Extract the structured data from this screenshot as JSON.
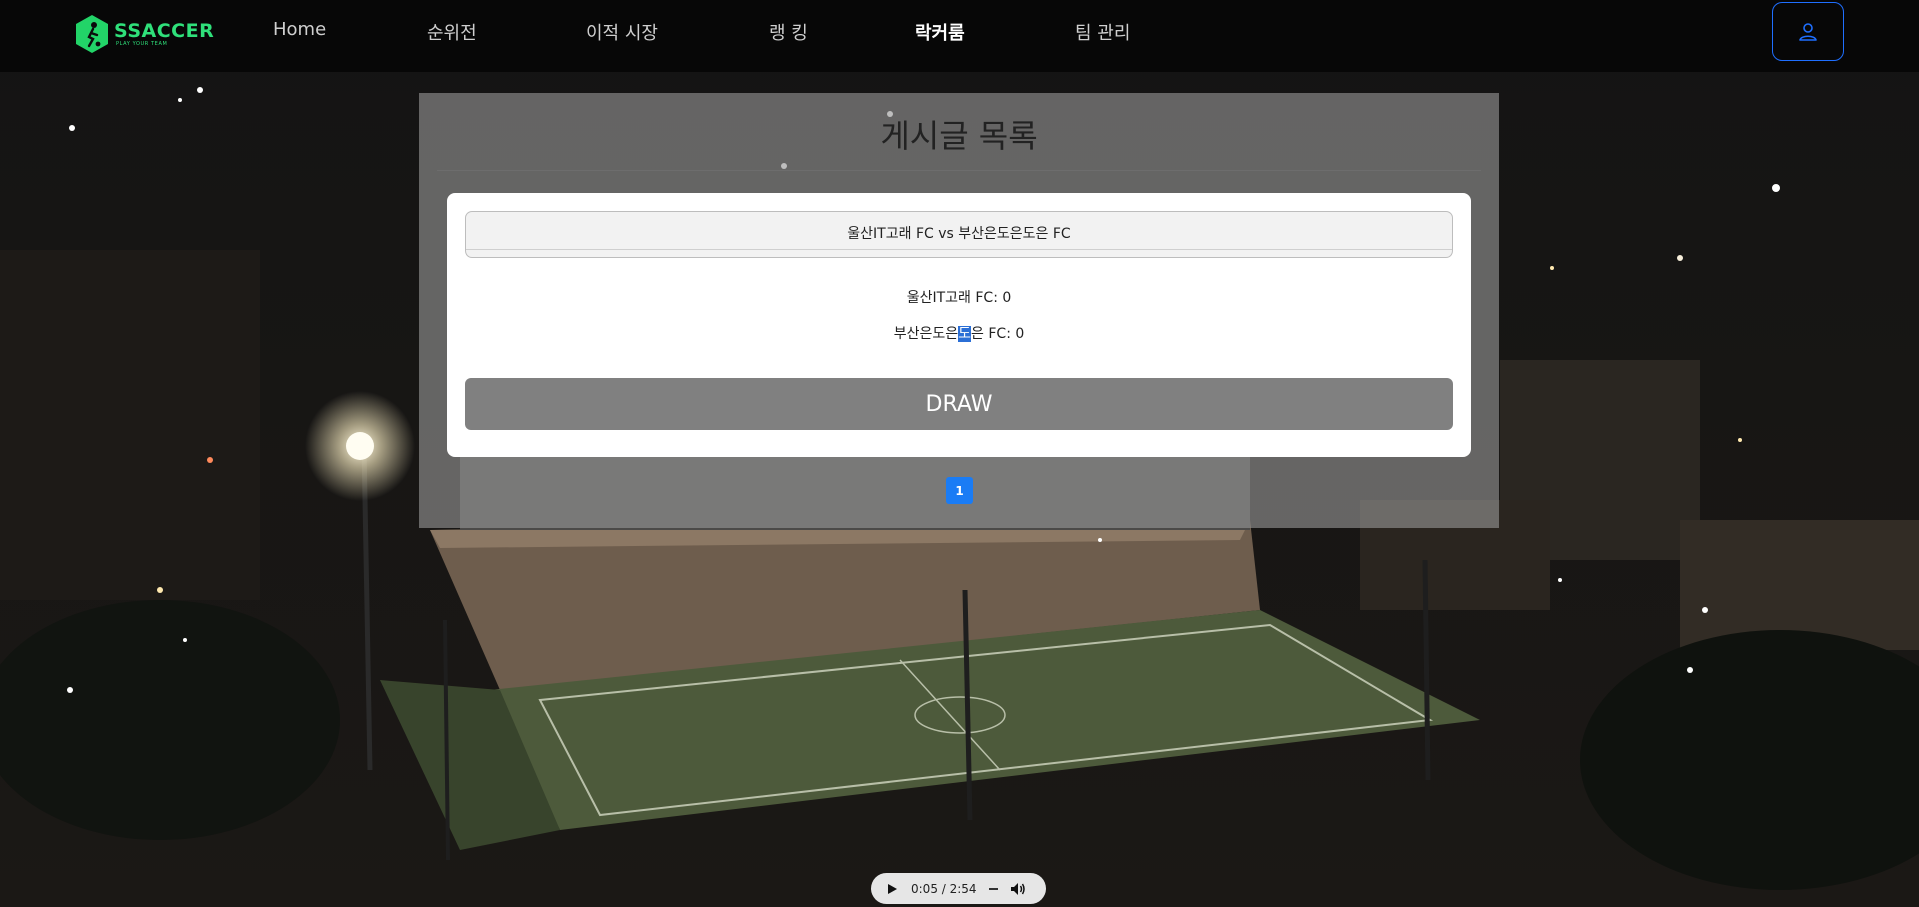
{
  "brand": {
    "name": "SSACCER",
    "tagline": "PLAY YOUR TEAM",
    "color": "#2fe07a"
  },
  "nav": {
    "items": [
      {
        "label": "Home"
      },
      {
        "label": "순위전"
      },
      {
        "label": "이적 시장"
      },
      {
        "label": "랭 킹"
      },
      {
        "label": "락커룸",
        "active": true
      },
      {
        "label": "팀 관리"
      }
    ],
    "user_icon": "user-icon"
  },
  "board": {
    "title": "게시글 목록",
    "posts": [
      {
        "match_title": "울산IT고래 FC vs 부산은도은도은 FC",
        "score_home": "울산IT고래 FC: 0",
        "score_away_prefix": "부산은도은",
        "score_away_highlight": "도",
        "score_away_suffix": "은 FC: 0",
        "result": "DRAW"
      }
    ],
    "pagination": {
      "current": "1"
    }
  },
  "audio": {
    "time": "0:05 / 2:54",
    "icons": [
      "play-icon",
      "volume-icon"
    ]
  },
  "colors": {
    "accent": "#1a7cf5",
    "draw_button": "#808080",
    "text_selection": "#2b6fd6"
  }
}
